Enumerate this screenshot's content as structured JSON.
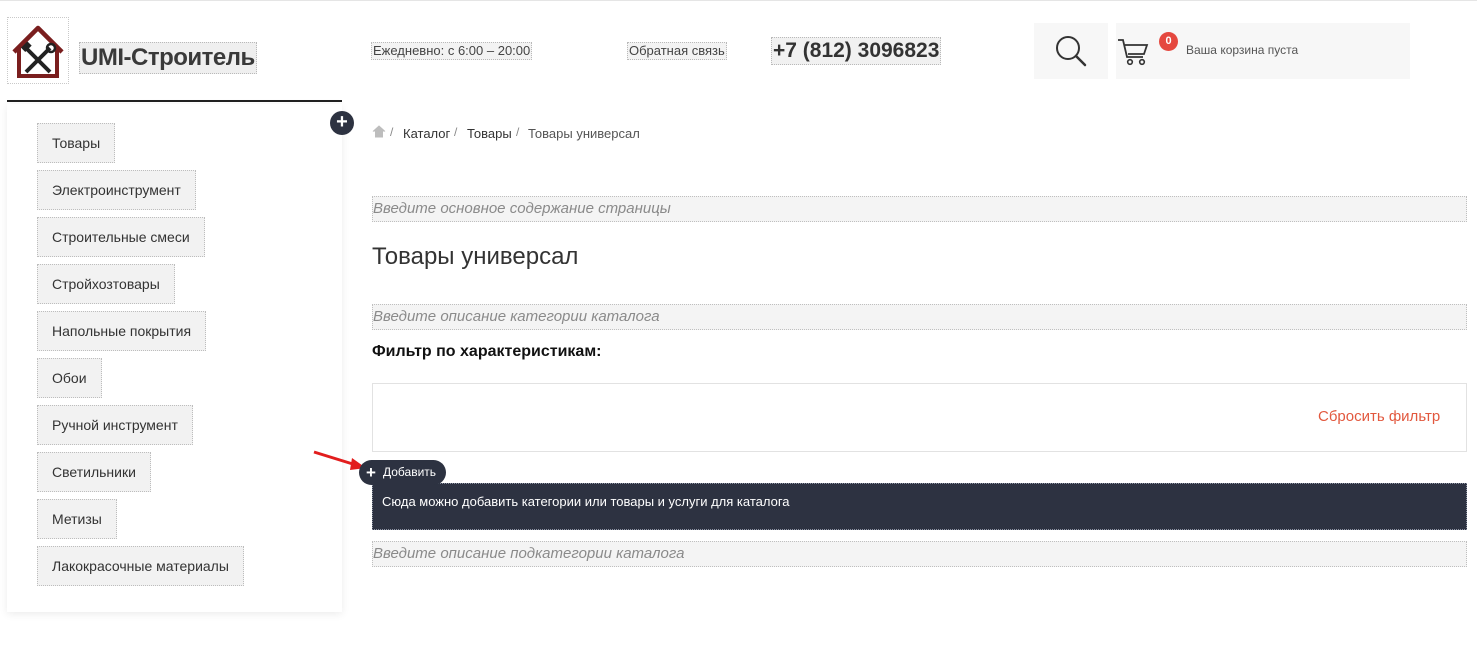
{
  "logo": {
    "title": "UMI-Строитель",
    "icon": "house-tools-logo"
  },
  "header": {
    "hours": "Ежедневно: с 6:00 – 20:00",
    "feedback": "Обратная связь",
    "phone": "+7 (812) 3096823",
    "search_icon": "search-icon",
    "cart": {
      "count": "0",
      "text": "Ваша корзина пуста",
      "icon": "cart-icon"
    }
  },
  "sidebar": {
    "items": [
      {
        "label": "Товары"
      },
      {
        "label": "Электроинструмент"
      },
      {
        "label": "Строительные смеси"
      },
      {
        "label": "Стройхозтовары"
      },
      {
        "label": "Напольные покрытия"
      },
      {
        "label": "Обои"
      },
      {
        "label": "Ручной инструмент"
      },
      {
        "label": "Светильники"
      },
      {
        "label": "Метизы"
      },
      {
        "label": "Лакокрасочные материалы"
      }
    ]
  },
  "breadcrumb": {
    "items": [
      "Каталог",
      "Товары",
      "Товары универсал"
    ],
    "separator": "/"
  },
  "main": {
    "content_placeholder": "Введите основное содержание страницы",
    "title": "Товары универсал",
    "category_desc_placeholder": "Введите описание категории каталога",
    "filter_label": "Фильтр по характеристикам:",
    "reset_filter": "Сбросить фильтр",
    "add_button": "Добавить",
    "add_hint": "Сюда можно добавить категории или товары и услуги для каталога",
    "subcategory_desc_placeholder": "Введите описание подкатегории каталога"
  },
  "colors": {
    "accent": "#e5483f",
    "dark": "#2d3241",
    "link_orange": "#e2583e"
  }
}
